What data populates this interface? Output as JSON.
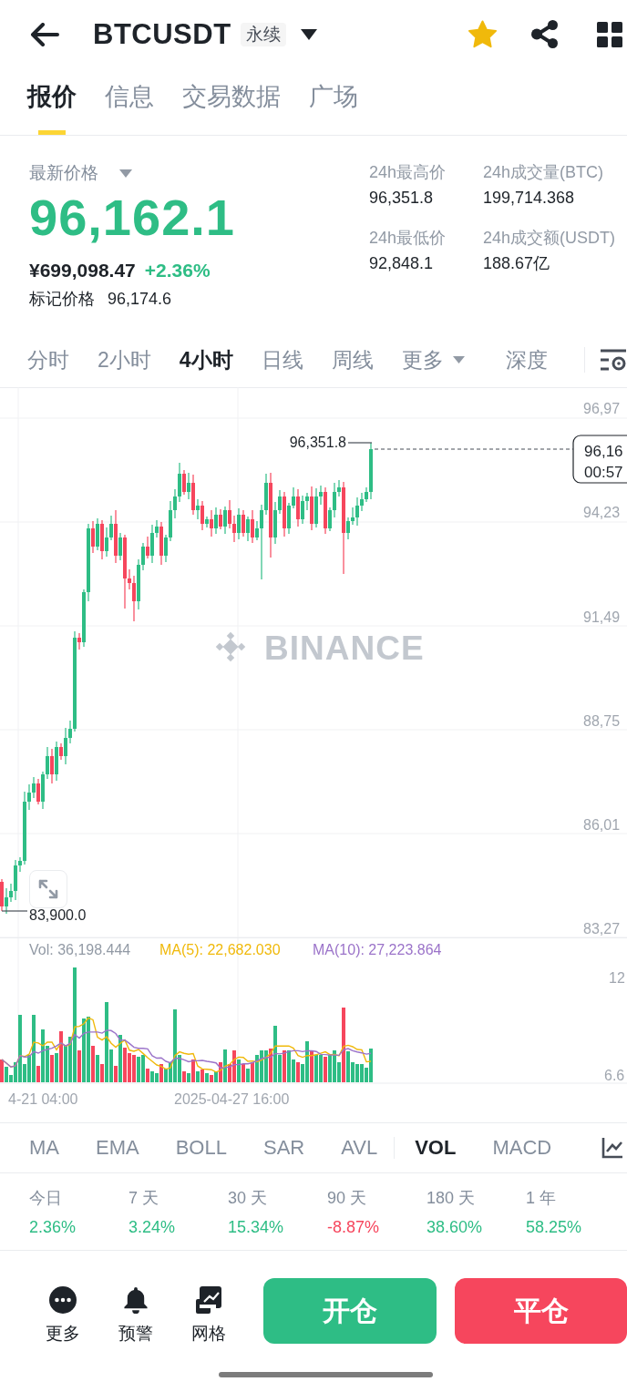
{
  "header": {
    "symbol": "BTCUSDT",
    "badge": "永续",
    "favorite": true
  },
  "tabs": [
    {
      "label": "报价",
      "selected": true
    },
    {
      "label": "信息",
      "selected": false
    },
    {
      "label": "交易数据",
      "selected": false
    },
    {
      "label": "广场",
      "selected": false
    }
  ],
  "price": {
    "label": "最新价格",
    "last": "96,162.1",
    "rising": true,
    "cny": "¥699,098.47",
    "change": "+2.36%",
    "mark_label": "标记价格",
    "mark_value": "96,174.6"
  },
  "stats": [
    {
      "label": "24h最高价",
      "value": "96,351.8"
    },
    {
      "label": "24h成交量(BTC)",
      "value": "199,714.368"
    },
    {
      "label": "24h最低价",
      "value": "92,848.1"
    },
    {
      "label": "24h成交额(USDT)",
      "value": "188.67亿"
    }
  ],
  "intervals": [
    {
      "label": "分时",
      "selected": false,
      "kind": "interval"
    },
    {
      "label": "2小时",
      "selected": false,
      "kind": "interval"
    },
    {
      "label": "4小时",
      "selected": true,
      "kind": "interval"
    },
    {
      "label": "日线",
      "selected": false,
      "kind": "interval"
    },
    {
      "label": "周线",
      "selected": false,
      "kind": "interval"
    },
    {
      "label": "更多",
      "selected": false,
      "kind": "menu"
    },
    {
      "label": "深度",
      "selected": false,
      "kind": "interval"
    }
  ],
  "chart": {
    "y_labels": [
      "96,97",
      "94,23",
      "91,49",
      "88,75",
      "86,01",
      "83,27"
    ],
    "high_label": "96,351.8",
    "low_label": "83,900.0",
    "price_tag": {
      "price": "96,16",
      "countdown": "00:57"
    },
    "watermark": "BINANCE",
    "volume_legend": [
      {
        "text": "Vol: 36,198.444",
        "color": "#929aa5"
      },
      {
        "text": "MA(5): 22,682.030",
        "color": "#f0b90b"
      },
      {
        "text": "MA(10): 27,223.864",
        "color": "#9b73c9"
      }
    ],
    "volume_labels": [
      "12",
      "6.6"
    ],
    "x_labels": [
      "4-21 04:00",
      "2025-04-27 16:00"
    ]
  },
  "indicators": [
    {
      "label": "MA",
      "selected": false,
      "kind": "main"
    },
    {
      "label": "EMA",
      "selected": false,
      "kind": "main"
    },
    {
      "label": "BOLL",
      "selected": false,
      "kind": "main"
    },
    {
      "label": "SAR",
      "selected": false,
      "kind": "main"
    },
    {
      "label": "AVL",
      "selected": false,
      "kind": "main"
    },
    {
      "label": "VOL",
      "selected": true,
      "kind": "sub"
    },
    {
      "label": "MACD",
      "selected": false,
      "kind": "sub"
    }
  ],
  "performance": [
    {
      "period": "今日",
      "value": "2.36%",
      "rising": true
    },
    {
      "period": "7 天",
      "value": "3.24%",
      "rising": true
    },
    {
      "period": "30 天",
      "value": "15.34%",
      "rising": true
    },
    {
      "period": "90 天",
      "value": "-8.87%",
      "rising": false
    },
    {
      "period": "180 天",
      "value": "38.60%",
      "rising": true
    },
    {
      "period": "1 年",
      "value": "58.25%",
      "rising": true
    }
  ],
  "actions": [
    {
      "label": "更多",
      "kind": "more"
    },
    {
      "label": "预警",
      "kind": "alert"
    },
    {
      "label": "网格",
      "kind": "grid"
    }
  ],
  "trade_buttons": [
    {
      "label": "开仓",
      "kind": "open"
    },
    {
      "label": "平仓",
      "kind": "close"
    }
  ]
}
